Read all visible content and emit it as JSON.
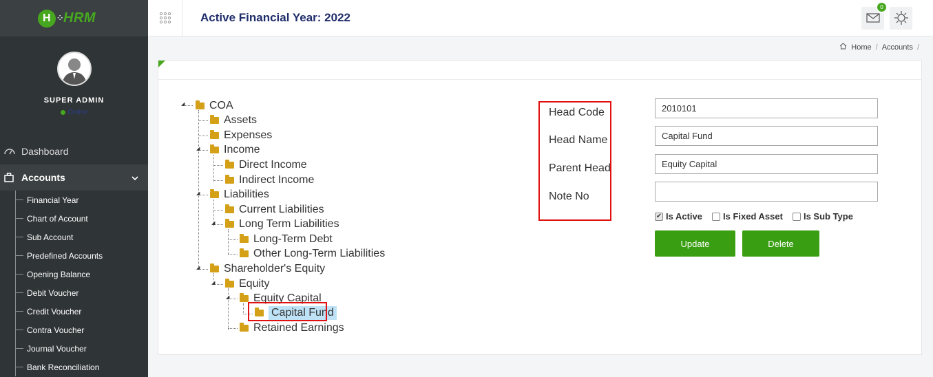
{
  "brand": {
    "logo_letter": "H",
    "logo_text": "HRM"
  },
  "profile": {
    "name": "SUPER ADMIN",
    "status": "Online"
  },
  "nav": {
    "dashboard": "Dashboard",
    "accounts": "Accounts",
    "accounts_sub": [
      "Financial Year",
      "Chart of Account",
      "Sub Account",
      "Predefined Accounts",
      "Opening Balance",
      "Debit Voucher",
      "Credit Voucher",
      "Contra Voucher",
      "Journal Voucher",
      "Bank Reconciliation"
    ]
  },
  "header": {
    "title": "Active Financial Year: 2022",
    "mail_badge": "0"
  },
  "breadcrumb": {
    "home": "Home",
    "accounts": "Accounts"
  },
  "tree": {
    "coa": "COA",
    "assets": "Assets",
    "expenses": "Expenses",
    "income": "Income",
    "direct_income": "Direct Income",
    "indirect_income": "Indirect Income",
    "liabilities": "Liabilities",
    "current_liabilities": "Current Liabilities",
    "long_term_liabilities": "Long Term Liabilities",
    "long_term_debt": "Long-Term Debt",
    "other_long_term": "Other Long-Term Liabilities",
    "shareholders_equity": "Shareholder's Equity",
    "equity": "Equity",
    "equity_capital": "Equity Capital",
    "capital_fund": "Capital Fund",
    "retained_earnings": "Retained Earnings"
  },
  "form": {
    "head_code_label": "Head Code",
    "head_name_label": "Head Name",
    "parent_head_label": "Parent Head",
    "note_no_label": "Note No",
    "head_code": "2010101",
    "head_name": "Capital Fund",
    "parent_head": "Equity Capital",
    "note_no": "",
    "is_active_label": "Is Active",
    "is_fixed_asset_label": "Is Fixed Asset",
    "is_sub_type_label": "Is Sub Type",
    "is_active": true,
    "is_fixed_asset": false,
    "is_sub_type": false,
    "update_label": "Update",
    "delete_label": "Delete"
  },
  "colors": {
    "accent": "#3a9e12",
    "sidebar": "#2f3436",
    "title": "#1f2d6b",
    "highlight_box": "#e01010"
  }
}
